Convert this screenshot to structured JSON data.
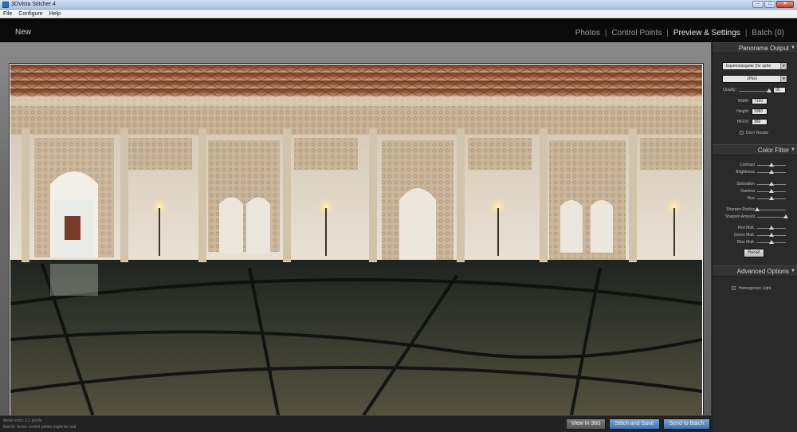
{
  "window": {
    "title": "3DVista Stitcher 4",
    "min": "–",
    "max": "□",
    "close": "✕"
  },
  "menu": [
    "File",
    "Configure",
    "Help"
  ],
  "nav": {
    "new": "New",
    "tabs": [
      {
        "label": "Photos",
        "active": false
      },
      {
        "label": "Control Points",
        "active": false
      },
      {
        "label": "Preview & Settings",
        "active": true
      },
      {
        "label": "Batch (0)",
        "active": false
      }
    ],
    "separator": "|"
  },
  "status": {
    "line1": "Mean error: 2.1 pixels",
    "line2": "Bad fit: Some control points might be bad",
    "buttons": {
      "view360": "View In 360",
      "stitch": "Stitch and Save",
      "batch": "Send to Batch"
    }
  },
  "panel": {
    "output": {
      "title": "Panorama Output",
      "projection": "Equirectangular (for sphe",
      "format": "JPEG",
      "quality_label": "Quality:",
      "quality": "95",
      "quality_level": 0.95,
      "width_label": "Width:",
      "width": "7100",
      "height_label": "Height:",
      "height": "3380",
      "hfov_label": "HFOV:",
      "hfov": "360",
      "dont_resize": "Don't Resize"
    },
    "color": {
      "title": "Color Filter",
      "sliders": [
        {
          "label": "Contrast",
          "level": 0.5
        },
        {
          "label": "Brightness",
          "level": 0.5
        },
        {
          "label": "Saturation",
          "level": 0.5
        },
        {
          "label": "Gamma",
          "level": 0.5
        },
        {
          "label": "Hue",
          "level": 0.5
        },
        {
          "label": "Sharpen Radius",
          "level": 0.0
        },
        {
          "label": "Sharpen Amount",
          "level": 1.0
        },
        {
          "label": "Red Mult.",
          "level": 0.5
        },
        {
          "label": "Green Mult.",
          "level": 0.5
        },
        {
          "label": "Blue Mult.",
          "level": 0.5
        }
      ],
      "reset": "Reset"
    },
    "advanced": {
      "title": "Advanced Options",
      "homogenize": "Homogenize Light"
    },
    "arrow": "▼"
  }
}
